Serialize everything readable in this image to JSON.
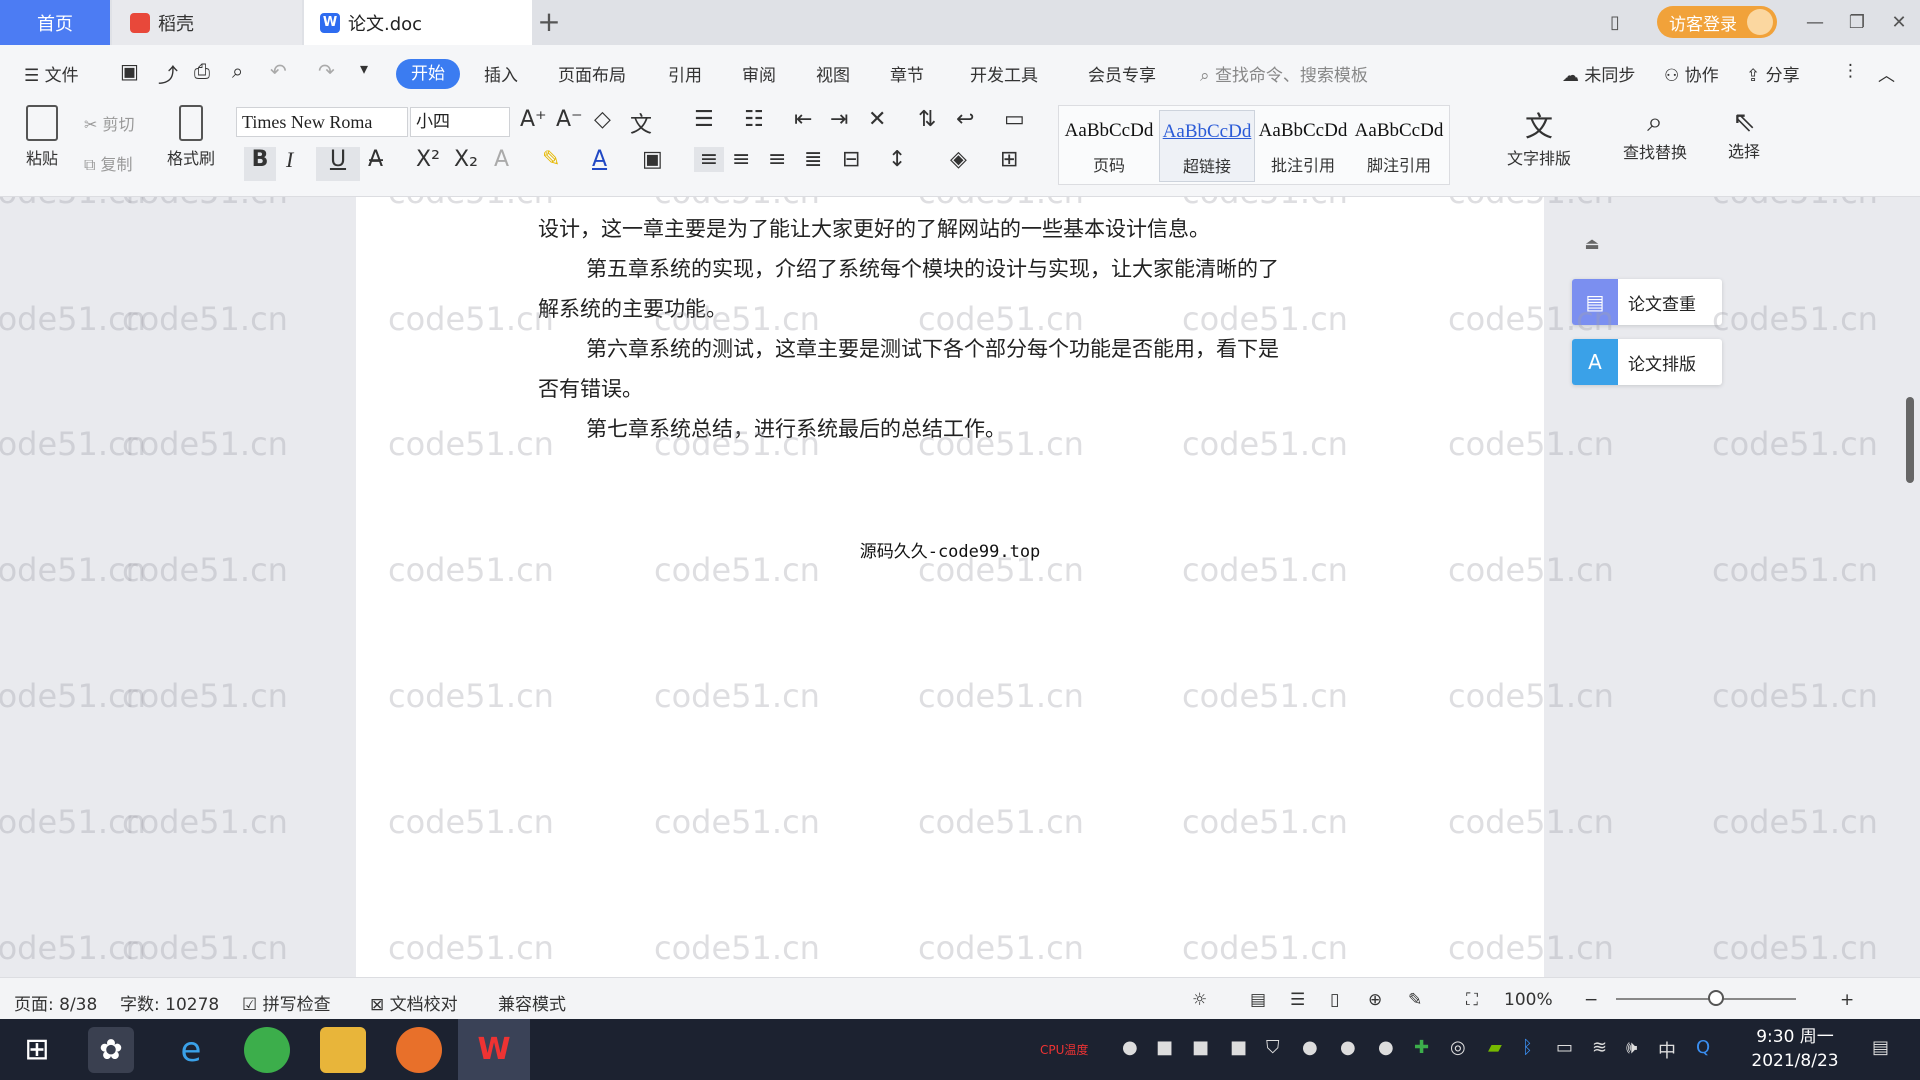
{
  "tabs": {
    "home": "首页",
    "daoke": "稻壳",
    "doc": "论文.doc",
    "add": "+"
  },
  "titlebar": {
    "login": "访客登录"
  },
  "menu": {
    "file": "文件",
    "items": [
      "开始",
      "插入",
      "页面布局",
      "引用",
      "审阅",
      "视图",
      "章节",
      "开发工具",
      "会员专享"
    ],
    "search_placeholder": "查找命令、搜索模板",
    "sync": "未同步",
    "collab": "协作",
    "share": "分享"
  },
  "ribbon": {
    "paste": "粘贴",
    "cut": "剪切",
    "copy": "复制",
    "format_painter": "格式刷",
    "font_name": "Times New Roma",
    "font_size": "小四",
    "styles": [
      {
        "sample": "AaBbCcDd",
        "name": "页码"
      },
      {
        "sample": "AaBbCcDd",
        "name": "超链接"
      },
      {
        "sample": "AaBbCcDd",
        "name": "批注引用"
      },
      {
        "sample": "AaBbCcDd",
        "name": "脚注引用"
      }
    ],
    "text_layout": "文字排版",
    "find_replace": "查找替换",
    "select": "选择"
  },
  "document": {
    "lines": [
      "设计，这一章主要是为了能让大家更好的了解网站的一些基本设计信息。",
      "第五章系统的实现，介绍了系统每个模块的设计与实现，让大家能清晰的了",
      "解系统的主要功能。",
      "第六章系统的测试，这章主要是测试下各个部分每个功能是否能用，看下是",
      "否有错误。",
      "第七章系统总结，进行系统最后的总结工作。"
    ],
    "footer": "源码久久-code99.top",
    "watermark": "code51.cn"
  },
  "side_panel": {
    "check": "论文查重",
    "layout": "论文排版"
  },
  "status": {
    "page": "页面: 8/38",
    "words": "字数: 10278",
    "spell": "拼写检查",
    "proof": "文档校对",
    "compat": "兼容模式",
    "zoom": "100%"
  },
  "taskbar": {
    "time": "9:30 周一",
    "date": "2021/8/23",
    "ime": "中",
    "cpu": "CPU温度"
  },
  "colors": {
    "accent": "#3b7cf1",
    "login": "#f1a23a",
    "taskbar": "#1c2230"
  }
}
